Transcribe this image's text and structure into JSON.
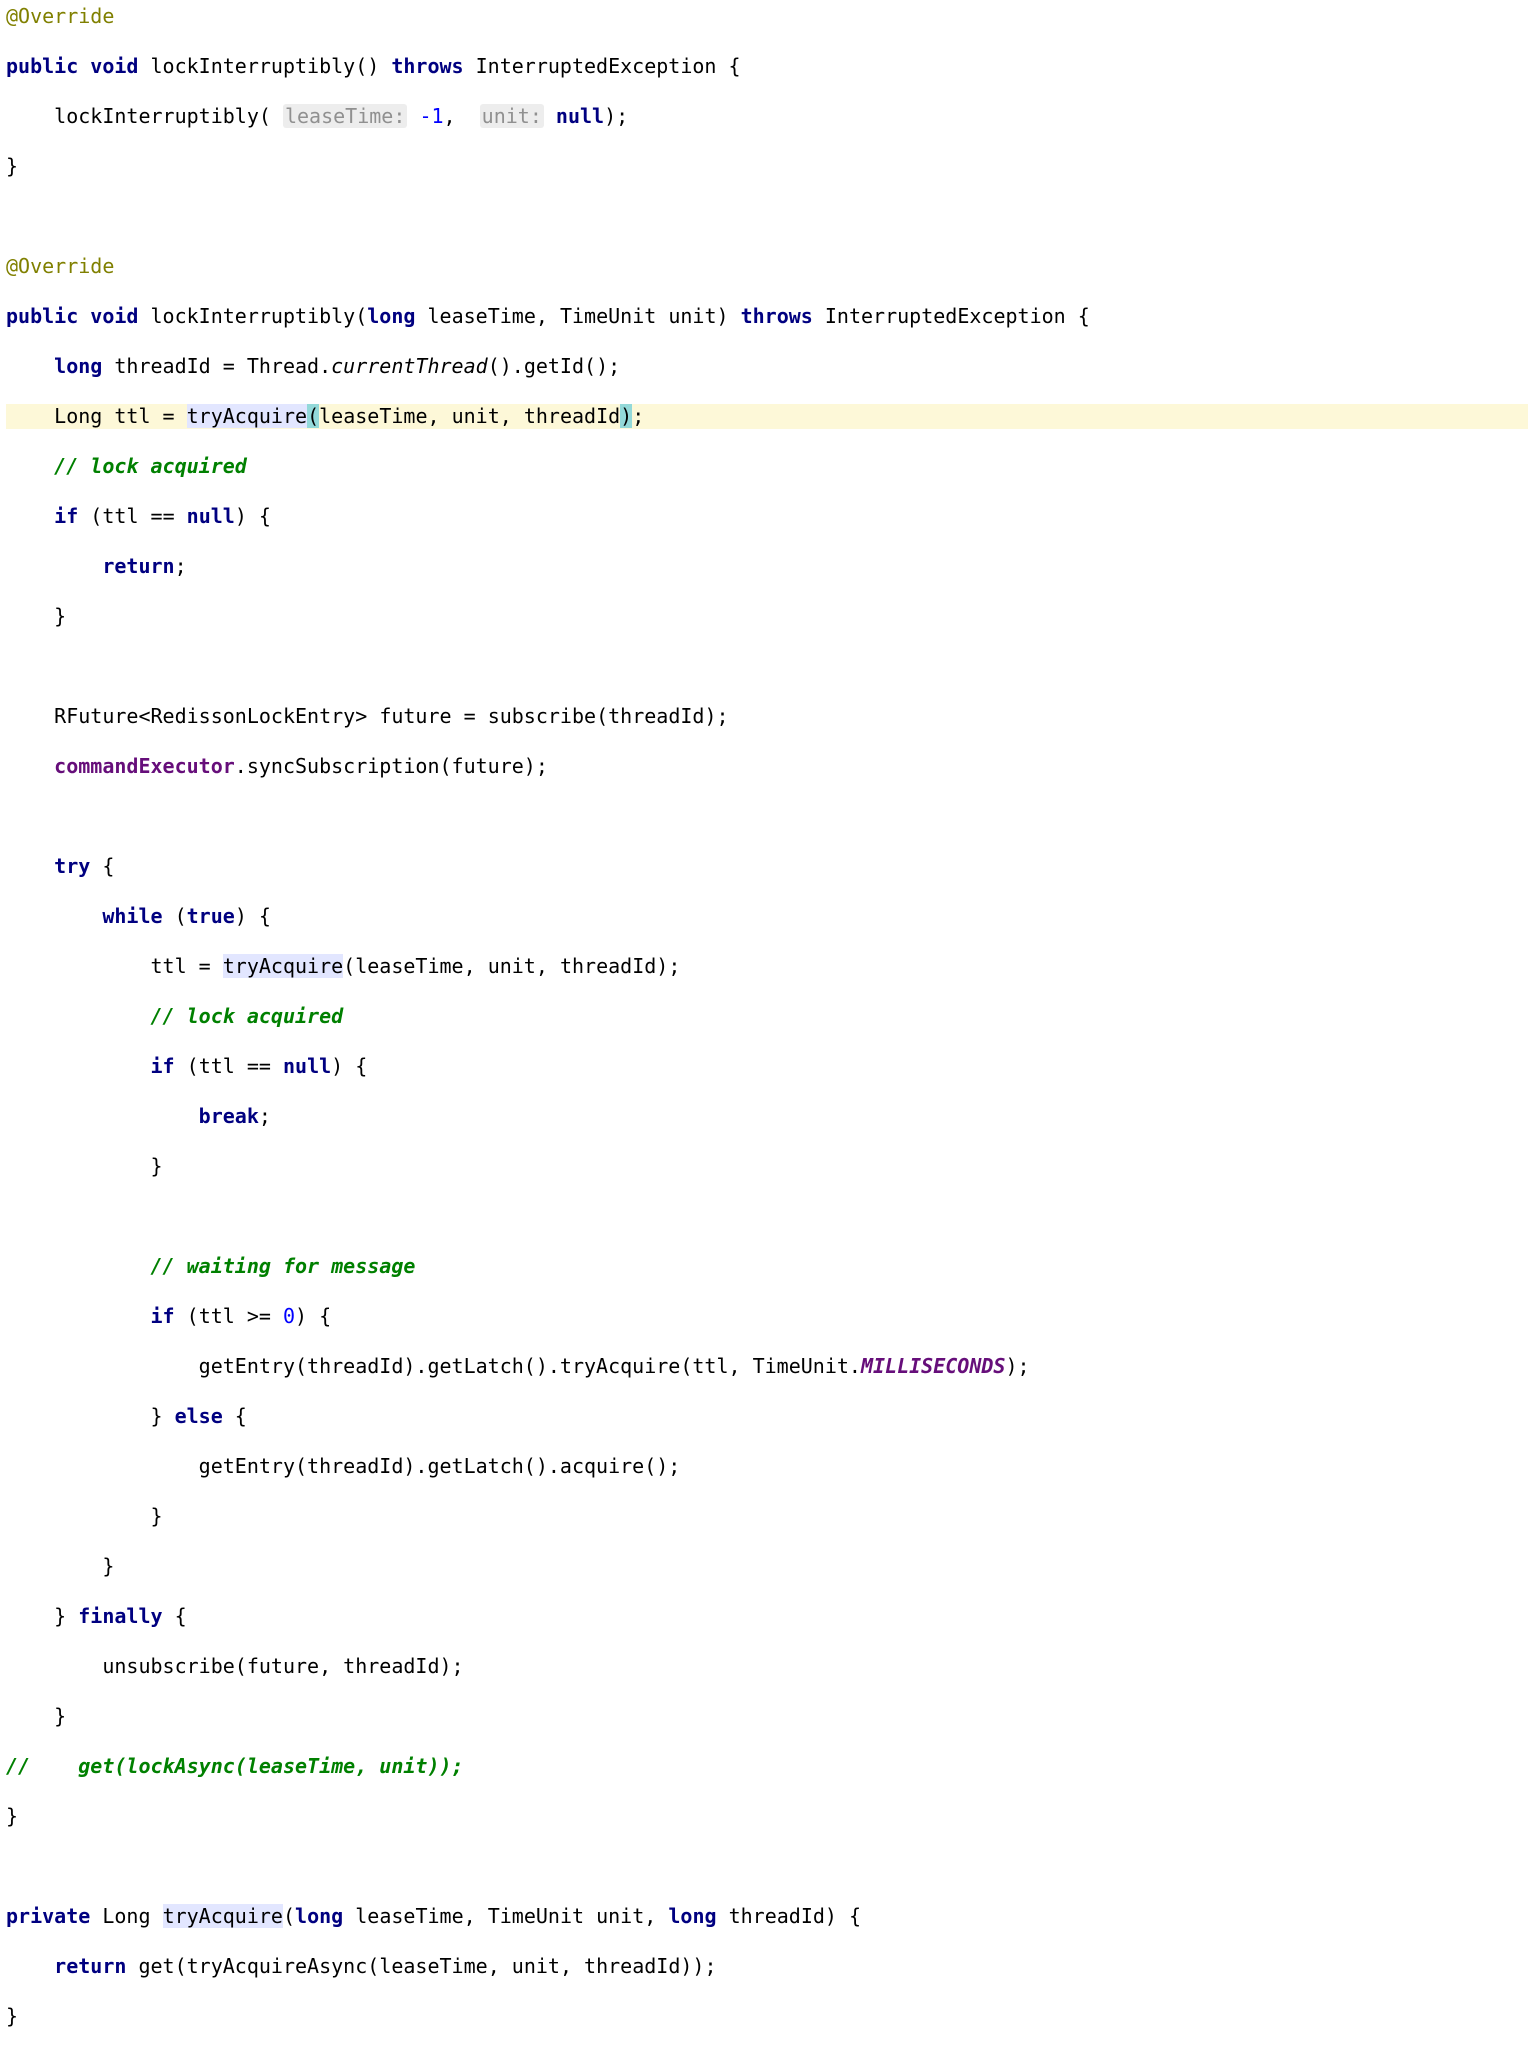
{
  "tokens": {
    "override": "@Override",
    "public": "public",
    "void": "void",
    "long_kw": "long",
    "throws": "throws",
    "return_kw": "return",
    "if_kw": "if",
    "null_kw": "null",
    "try_kw": "try",
    "while_kw": "while",
    "true_kw": "true",
    "break_kw": "break",
    "else_kw": "else",
    "finally_kw": "finally",
    "private_kw": "private"
  },
  "names": {
    "lockInterruptibly": "lockInterruptibly",
    "InterruptedException": "InterruptedException",
    "leaseTime_hint": "leaseTime:",
    "unit_hint": "unit:",
    "leaseTime": "leaseTime",
    "TimeUnit": "TimeUnit",
    "unit": "unit",
    "threadId": "threadId",
    "Thread": "Thread",
    "currentThread": "currentThread",
    "getId": "getId",
    "Long_t": "Long",
    "ttl": "ttl",
    "tryAcquire": "tryAcquire",
    "lock_acquired": "// lock acquired",
    "RFuture": "RFuture",
    "RedissonLockEntry": "RedissonLockEntry",
    "future": "future",
    "subscribe": "subscribe",
    "commandExecutor": "commandExecutor",
    "syncSubscription": "syncSubscription",
    "waiting_for_message": "// waiting for message",
    "getEntry": "getEntry",
    "getLatch": "getLatch",
    "MILLISECONDS": "MILLISECONDS",
    "acquire": "acquire",
    "unsubscribe": "unsubscribe",
    "getlockasync": "get(lockAsync(leaseTime, unit));",
    "tryAcquireAsync": "tryAcquireAsync",
    "get": "get"
  },
  "nums": {
    "minus1": "-1",
    "zero": "0"
  }
}
